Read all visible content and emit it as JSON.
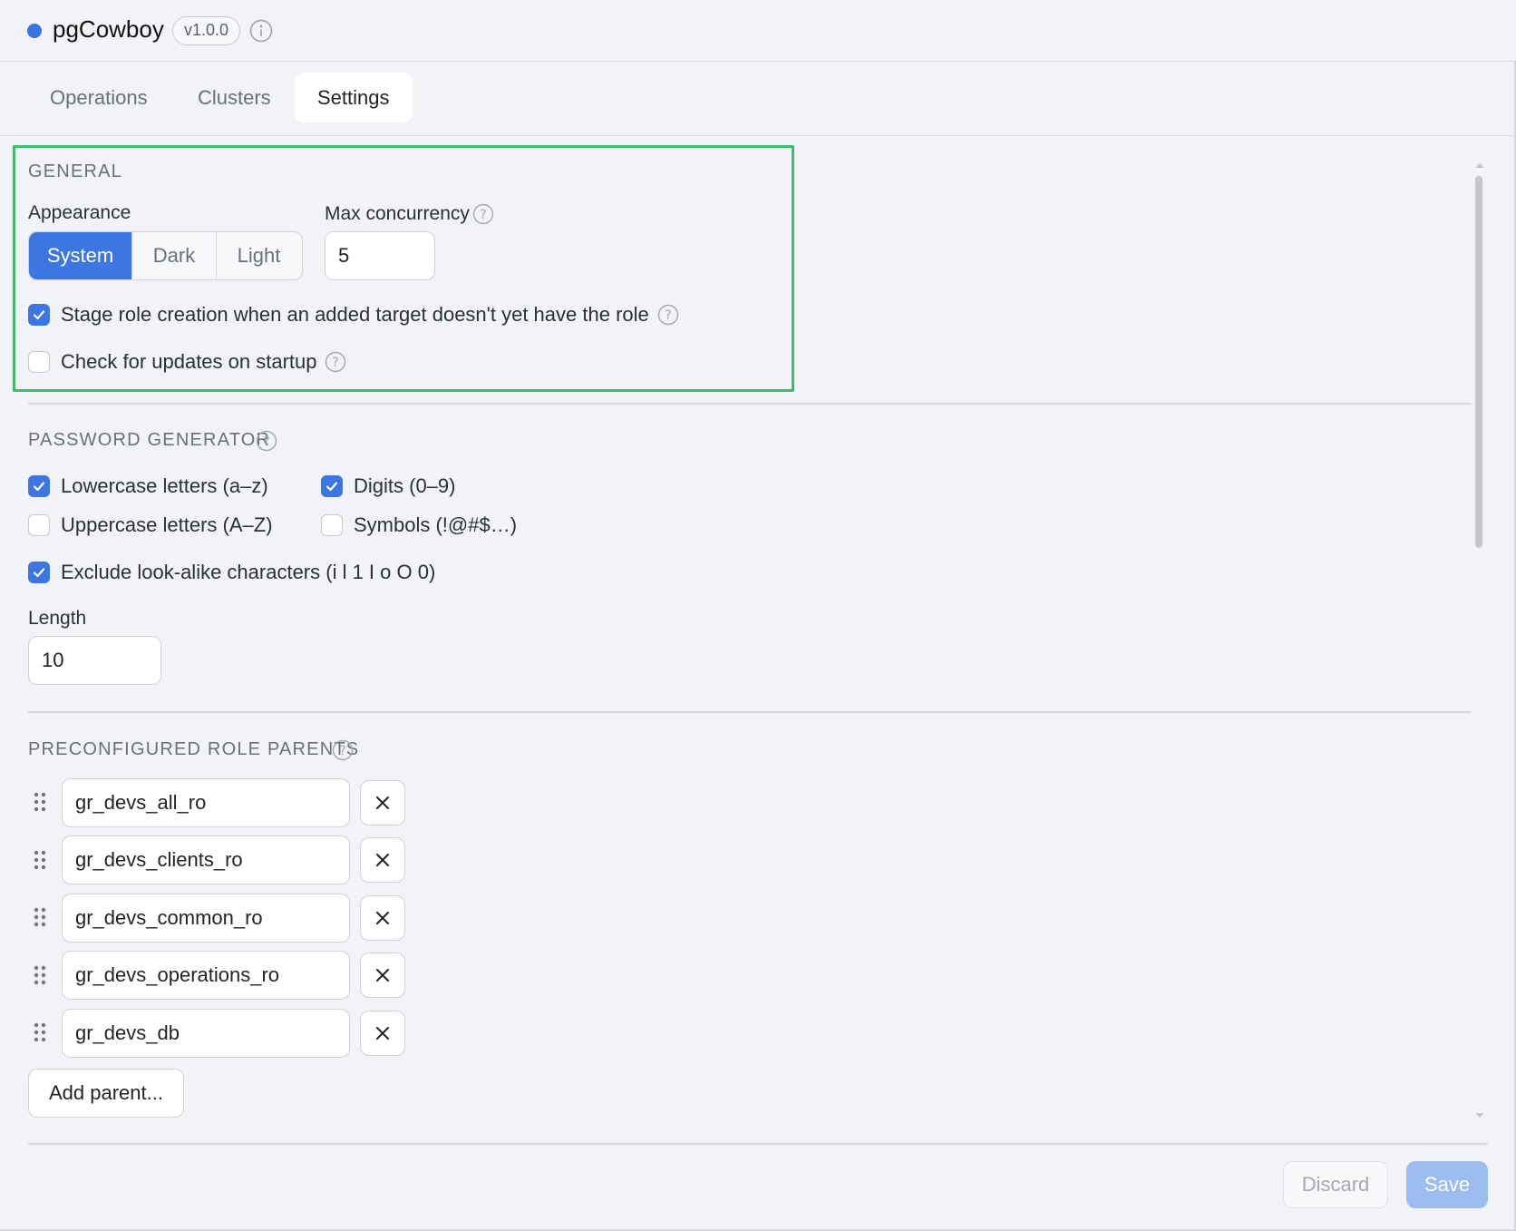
{
  "app": {
    "name": "pgCowboy",
    "version": "v1.0.0"
  },
  "tabs": [
    {
      "label": "Operations"
    },
    {
      "label": "Clusters"
    },
    {
      "label": "Settings"
    }
  ],
  "general": {
    "title": "GENERAL",
    "appearance_label": "Appearance",
    "appearance_options": [
      "System",
      "Dark",
      "Light"
    ],
    "appearance_selected": "System",
    "max_concurrency_label": "Max concurrency",
    "max_concurrency_value": "5",
    "stage_role_label": "Stage role creation when an added target doesn't yet have the role",
    "stage_role_checked": true,
    "check_updates_label": "Check for updates on startup",
    "check_updates_checked": false
  },
  "password_generator": {
    "title": "PASSWORD GENERATOR",
    "lowercase_label": "Lowercase letters (a–z)",
    "lowercase_checked": true,
    "digits_label": "Digits (0–9)",
    "digits_checked": true,
    "uppercase_label": "Uppercase letters (A–Z)",
    "uppercase_checked": false,
    "symbols_label": "Symbols (!@#$…)",
    "symbols_checked": false,
    "exclude_label": "Exclude look-alike characters (i l 1 I o O 0)",
    "exclude_checked": true,
    "length_label": "Length",
    "length_value": "10"
  },
  "role_parents": {
    "title": "PRECONFIGURED ROLE PARENTS",
    "items": [
      "gr_devs_all_ro",
      "gr_devs_clients_ro",
      "gr_devs_common_ro",
      "gr_devs_operations_ro",
      "gr_devs_db"
    ],
    "add_label": "Add parent..."
  },
  "footer": {
    "discard_label": "Discard",
    "save_label": "Save"
  },
  "colors": {
    "accent": "#3c76e3",
    "highlight": "#3cbf6a",
    "save_disabled": "#9dbdf1"
  }
}
